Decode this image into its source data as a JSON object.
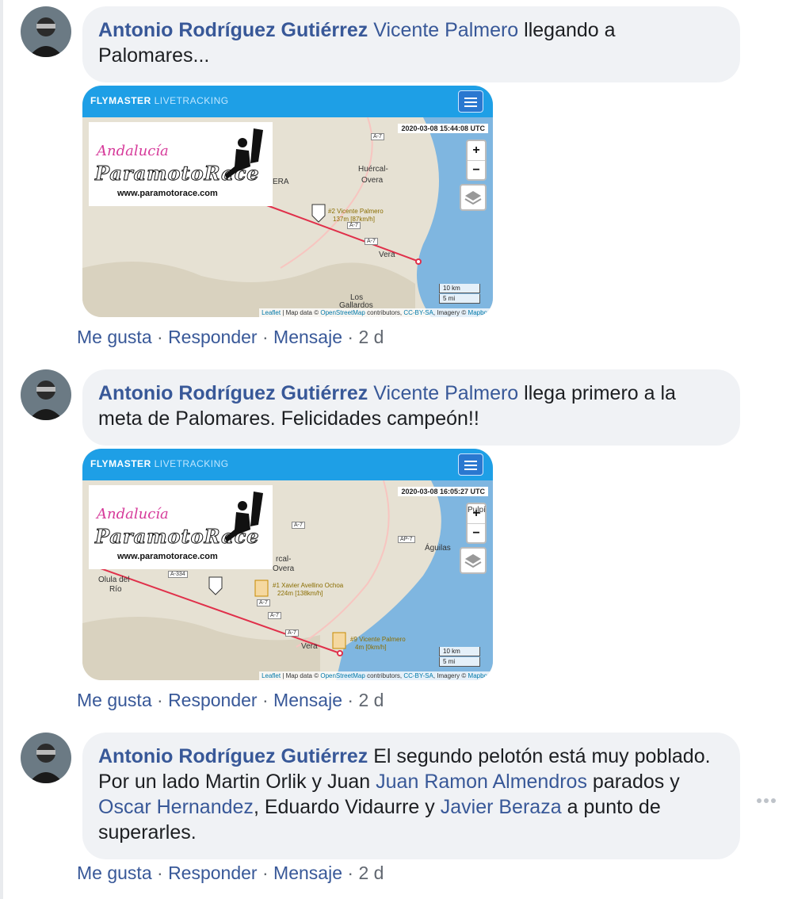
{
  "comments": [
    {
      "author": "Antonio Rodríguez Gutiérrez",
      "mention": "Vicente Palmero",
      "text": "llegando a Palomares...",
      "map": {
        "brand": "FLYMASTER",
        "brand_sub": "LIVETRACKING",
        "timestamp": "2020-03-08 15:44:08 UTC",
        "logo_andalucia": "Andalucía",
        "logo_race": "ParamotoRace",
        "logo_url": "www.paramotorace.com",
        "places": [
          "Huércal-",
          "Overa",
          "Vera",
          "Los",
          "Gallardos",
          "ERA"
        ],
        "roads": [
          "A-7",
          "A-7",
          "A-7"
        ],
        "pilot_label_1": "#2 Vicente Palmero",
        "pilot_label_2": "137m [87km/h]",
        "scale_km": "10 km",
        "scale_mi": "5 mi",
        "attrib_leaflet": "Leaflet",
        "attrib_text": "| Map data ©",
        "attrib_osm": "OpenStreetMap",
        "attrib_text2": "contributors,",
        "attrib_cc": "CC-BY-SA",
        "attrib_text3": ", Imagery ©",
        "attrib_mapbox": "Mapbox"
      },
      "actions": {
        "like": "Me gusta",
        "reply": "Responder",
        "message": "Mensaje",
        "sep": "·",
        "age": "2 d"
      }
    },
    {
      "author": "Antonio Rodríguez Gutiérrez",
      "mention": "Vicente Palmero",
      "text": "llega primero a la meta de Palomares. Felicidades campeón!!",
      "map": {
        "brand": "FLYMASTER",
        "brand_sub": "LIVETRACKING",
        "timestamp": "2020-03-08 16:05:27 UTC",
        "logo_andalucia": "Andalucía",
        "logo_race": "ParamotoRace",
        "logo_url": "www.paramotorace.com",
        "places": [
          "Olula del",
          "Río",
          "rcal-",
          "Overa",
          "Águilas",
          "Vera",
          "Pulpí"
        ],
        "roads": [
          "A-334",
          "A-7",
          "AP-7",
          "A-7",
          "A-7",
          "A-7"
        ],
        "pilot_label_1": "#1 Xavier Avellino Ochoa",
        "pilot_label_2": "224m [138km/h]",
        "pilot_label_3": "#9 Vicente Palmero",
        "pilot_label_4": "4m [0km/h]",
        "scale_km": "10 km",
        "scale_mi": "5 mi",
        "attrib_leaflet": "Leaflet",
        "attrib_text": "| Map data ©",
        "attrib_osm": "OpenStreetMap",
        "attrib_text2": "contributors,",
        "attrib_cc": "CC-BY-SA",
        "attrib_text3": ", Imagery ©",
        "attrib_mapbox": "Mapbox"
      },
      "actions": {
        "like": "Me gusta",
        "reply": "Responder",
        "message": "Mensaje",
        "sep": "·",
        "age": "2 d"
      }
    },
    {
      "author": "Antonio Rodríguez Gutiérrez",
      "text_a": "El segundo pelotón está muy poblado. Por un lado Martin Orlik y Juan",
      "mention_a": "Juan Ramon Almendros",
      "text_b": "parados y",
      "mention_b": "Oscar Hernandez",
      "text_c": ", Eduardo Vidaurre y",
      "mention_c": "Javier Beraza",
      "text_d": "a punto de superarles.",
      "actions": {
        "like": "Me gusta",
        "reply": "Responder",
        "message": "Mensaje",
        "sep": "·",
        "age": "2 d"
      }
    }
  ],
  "colors": {
    "link": "#385898",
    "bubble": "#f0f2f5",
    "header": "#1e9fe6",
    "sea": "#7fb6e0"
  }
}
